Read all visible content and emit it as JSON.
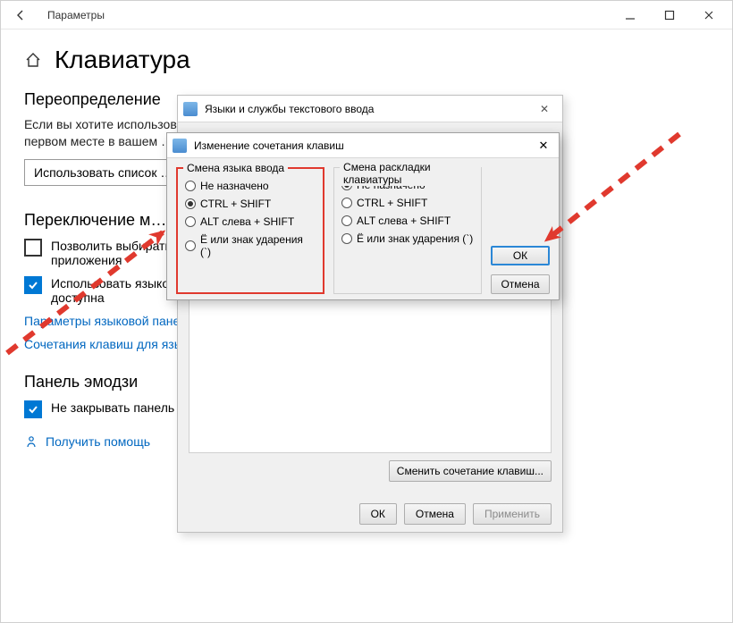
{
  "window": {
    "title": "Параметры",
    "page_header": "Клавиатура"
  },
  "sections": {
    "override": {
      "title": "Переопределение",
      "desc_line1": "Если вы хотите использовать …",
      "desc_line2": "первом месте в вашем …",
      "button_label": "Использовать список …"
    },
    "switching": {
      "title": "Переключение м…",
      "chk_allow": "Позволить выбирать м…",
      "chk_allow_line2": "приложения",
      "chk_uselangbar": "Использовать языкову…",
      "chk_uselangbar_line2": "доступна",
      "link_params": "Параметры языковой пане…",
      "link_shortcuts": "Сочетания клавиш для язы…"
    },
    "emoji": {
      "title": "Панель эмодзи",
      "chk": "Не закрывать панель автоматически после ввода эмодзи"
    },
    "help": {
      "link": "Получить помощь"
    }
  },
  "dialog_rear": {
    "title": "Языки и службы текстового ввода",
    "btn_change": "Сменить сочетание клавиш...",
    "btn_ok": "ОК",
    "btn_cancel": "Отмена",
    "btn_apply": "Применить"
  },
  "dialog_front": {
    "title": "Изменение сочетания клавиш",
    "group_lang": "Смена языка ввода",
    "group_layout": "Смена раскладки клавиатуры",
    "opt_none": "Не назначено",
    "opt_ctrlshift": "CTRL + SHIFT",
    "opt_altshift": "ALT слева + SHIFT",
    "opt_grave": "Ё или знак ударения (`)",
    "btn_ok": "ОК",
    "btn_cancel": "Отмена"
  }
}
